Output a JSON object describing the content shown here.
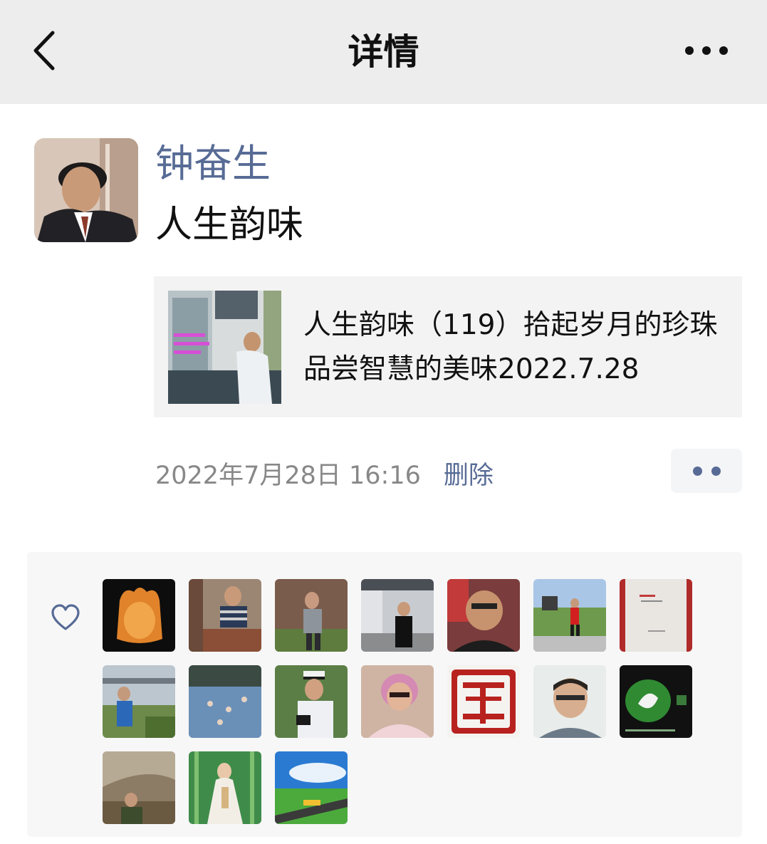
{
  "header": {
    "title": "详情",
    "back_icon": "chevron-left-icon",
    "more_icon": "more-dots-icon"
  },
  "post": {
    "author": "钟奋生",
    "text": "人生韵味",
    "article": {
      "title": "人生韵味（119）拾起岁月的珍珠  品尝智慧的美味2022.7.28"
    },
    "timestamp": "2022年7月28日 16:16",
    "delete_label": "删除"
  },
  "likes": {
    "icon": "heart-outline-icon",
    "count": 17
  },
  "colors": {
    "link": "#576b95",
    "header_bg": "#ededed",
    "likes_bg": "#f7f7f7"
  }
}
